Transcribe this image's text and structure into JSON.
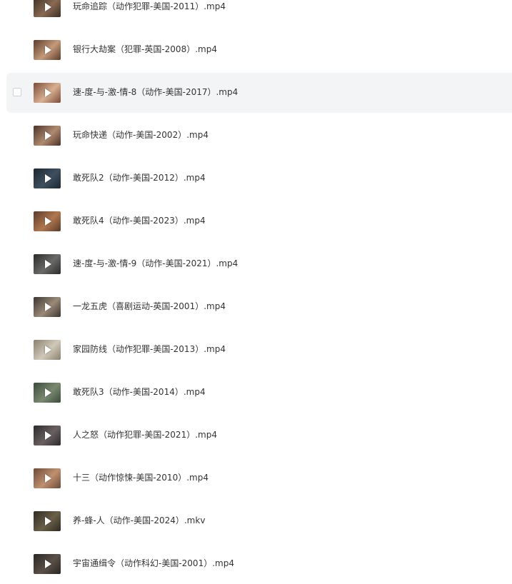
{
  "files": [
    {
      "name": "玩命追踪（动作犯罪-美国-2011）.mp4",
      "thumb_colors": [
        "#3b2f26",
        "#8a6a52"
      ]
    },
    {
      "name": "银行大劫案（犯罪-英国-2008）.mp4",
      "thumb_colors": [
        "#5a3b2a",
        "#c49a7a"
      ]
    },
    {
      "name": "速-度-与-激-情-8（动作-美国-2017）.mp4",
      "thumb_colors": [
        "#7a4a3a",
        "#d8b090"
      ],
      "hovered": true
    },
    {
      "name": "玩命快递（动作-美国-2002）.mp4",
      "thumb_colors": [
        "#4a3228",
        "#b08a70"
      ]
    },
    {
      "name": "敢死队2（动作-美国-2012）.mp4",
      "thumb_colors": [
        "#1c2630",
        "#3d5060"
      ]
    },
    {
      "name": "敢死队4（动作-美国-2023）.mp4",
      "thumb_colors": [
        "#5a3a28",
        "#b07850"
      ]
    },
    {
      "name": "速-度-与-激-情-9（动作-美国-2021）.mp4",
      "thumb_colors": [
        "#2a2a2a",
        "#6a6a68"
      ]
    },
    {
      "name": "一龙五虎（喜剧运动-英国-2001）.mp4",
      "thumb_colors": [
        "#3a3530",
        "#9a8a78"
      ]
    },
    {
      "name": "家园防线（动作犯罪-美国-2013）.mp4",
      "thumb_colors": [
        "#8a8070",
        "#d0c8b8"
      ]
    },
    {
      "name": "敢死队3（动作-美国-2014）.mp4",
      "thumb_colors": [
        "#3a4a3a",
        "#7a8a70"
      ]
    },
    {
      "name": "人之怒（动作犯罪-美国-2021）.mp4",
      "thumb_colors": [
        "#2a2a2e",
        "#6a6060"
      ]
    },
    {
      "name": "十三（动作惊悚-美国-2010）.mp4",
      "thumb_colors": [
        "#6a4a38",
        "#c09070"
      ]
    },
    {
      "name": "养-蜂-人（动作-美国-2024）.mkv",
      "thumb_colors": [
        "#2e2a22",
        "#6a6048"
      ]
    },
    {
      "name": "宇宙通缉令（动作科幻-美国-2001）.mp4",
      "thumb_colors": [
        "#2a2622",
        "#5a5048"
      ]
    }
  ],
  "icons": {
    "play": "play-icon",
    "checkbox": "checkbox"
  }
}
